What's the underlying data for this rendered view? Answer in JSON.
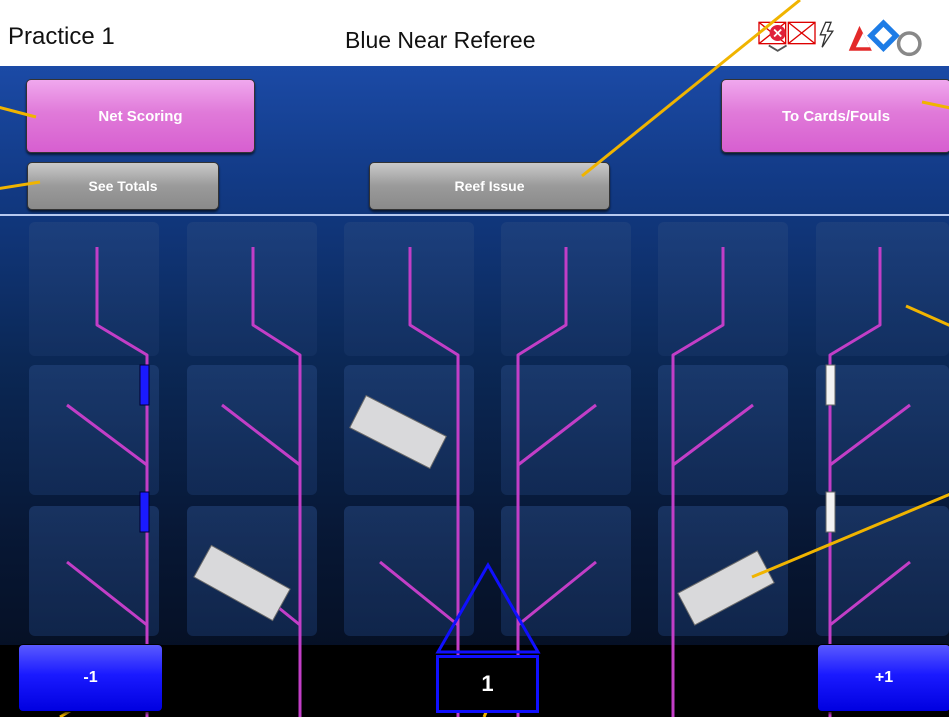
{
  "header": {
    "match_name": "Practice 1",
    "station_name": "Blue Near Referee"
  },
  "buttons": {
    "net_scoring": "Net Scoring",
    "to_cards_fouls": "To Cards/Fouls",
    "see_totals": "See Totals",
    "reef_issue": "Reef Issue",
    "minus_one": "-1",
    "plus_one": "+1"
  },
  "counter": {
    "value": "1"
  },
  "icons": [
    "connection-error-icon",
    "broken-image-icon",
    "battery-charging-icon",
    "first-logo-icon"
  ],
  "colors": {
    "pink_button": "#e07ad9",
    "gray_button": "#9a9a9a",
    "blue_button": "#1a1aff",
    "branch": "#c23ec7",
    "divider": "#b7c9ef"
  }
}
